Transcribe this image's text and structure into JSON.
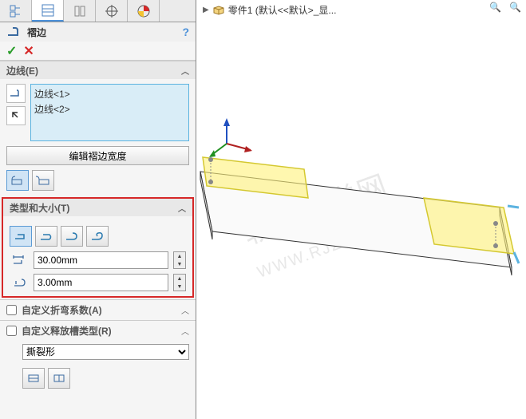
{
  "tree": {
    "part_label": "零件1  (默认<<默认>_显..."
  },
  "feature": {
    "title": "褶边"
  },
  "sections": {
    "edges": {
      "title": "边线(E)"
    },
    "type_size": {
      "title": "类型和大小(T)"
    },
    "bend_allow": {
      "title": "自定义折弯系数(A)"
    },
    "relief": {
      "title": "自定义释放槽类型(R)"
    }
  },
  "edges": {
    "items": [
      "边线<1>",
      "边线<2>"
    ]
  },
  "buttons": {
    "edit_hem_width": "编辑褶边宽度"
  },
  "inputs": {
    "length": {
      "value": "30.00mm"
    },
    "gap": {
      "value": "3.00mm"
    }
  },
  "relief_select": {
    "selected": "撕裂形"
  },
  "icons": {
    "feature": "hem-icon",
    "edge_pick": "edge-icon",
    "reverse": "reverse-icon"
  }
}
